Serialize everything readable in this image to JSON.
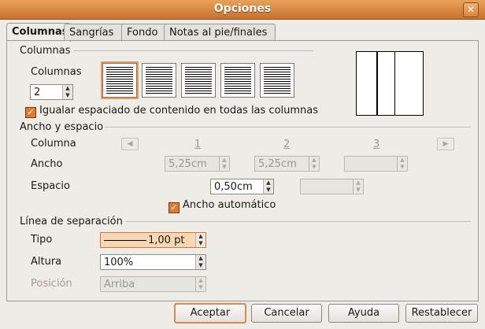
{
  "window": {
    "title": "Opciones",
    "close_symbol": "✕"
  },
  "tabs": [
    "Columnas",
    "Sangrías",
    "Fondo",
    "Notas al pie/finales"
  ],
  "columns_section": {
    "title": "Columnas",
    "columns_label": "Columnas",
    "columns_value": "2",
    "equal_spacing_label": "Igualar espaciado de contenido en todas las columnas",
    "equal_spacing_checked": true
  },
  "width_spacing": {
    "title": "Ancho y espacio",
    "column_label": "Columna",
    "column_numbers": [
      "1",
      "2",
      "3"
    ],
    "width_label": "Ancho",
    "width_values": [
      "5,25cm",
      "5,25cm",
      ""
    ],
    "spacing_label": "Espacio",
    "spacing_values": [
      "0,50cm",
      ""
    ],
    "auto_width_label": "Ancho automático",
    "auto_width_checked": true
  },
  "separator": {
    "title": "Línea de separación",
    "type_label": "Tipo",
    "type_value": "1,00 pt",
    "height_label": "Altura",
    "height_value": "100%",
    "position_label": "Posición",
    "position_value": "Arriba"
  },
  "buttons": {
    "ok": "Aceptar",
    "cancel": "Cancelar",
    "help": "Ayuda",
    "reset": "Restablecer"
  }
}
